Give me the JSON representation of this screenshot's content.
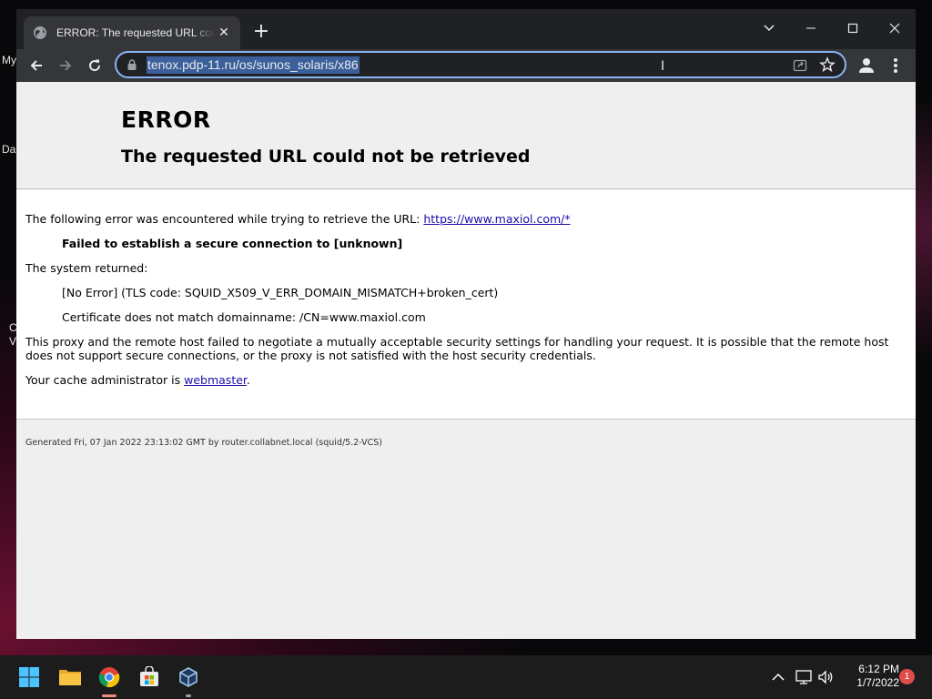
{
  "desktop": {
    "labels": [
      "My",
      "Da",
      "C",
      "V"
    ]
  },
  "browser": {
    "tab": {
      "title": "ERROR: The requested URL could not be retrieved",
      "favicon": "globe-icon"
    },
    "window_controls": [
      "chevron-down-icon",
      "minimize-icon",
      "maximize-icon",
      "close-icon"
    ],
    "address_bar": {
      "url": "tenox.pdp-11.ru/os/sunos_solaris/x86"
    },
    "accent_color": "#8ab4f8"
  },
  "page": {
    "heading": "ERROR",
    "subheading": "The requested URL could not be retrieved",
    "intro_text": "The following error was encountered while trying to retrieve the URL: ",
    "intro_link": "https://www.maxiol.com/*",
    "failure": "Failed to establish a secure connection to [unknown]",
    "system_returned": "The system returned:",
    "error_code": "[No Error] (TLS code: SQUID_X509_V_ERR_DOMAIN_MISMATCH+broken_cert)",
    "cert_detail": "Certificate does not match domainname: /CN=www.maxiol.com",
    "explanation": "This proxy and the remote host failed to negotiate a mutually acceptable security settings for handling your request. It is possible that the remote host does not support secure connections, or the proxy is not satisfied with the host security credentials.",
    "admin_prefix": "Your cache administrator is ",
    "admin_link": "webmaster",
    "admin_suffix": ".",
    "footer": "Generated Fri, 07 Jan 2022 23:13:02 GMT by router.collabnet.local (squid/5.2-VCS)"
  },
  "taskbar": {
    "apps": [
      "windows-start-icon",
      "file-explorer-icon",
      "chrome-icon",
      "store-icon",
      "virtualbox-icon"
    ],
    "tray_icons": [
      "chevron-up-icon",
      "network-icon",
      "volume-icon"
    ],
    "time": "6:12 PM",
    "date": "1/7/2022",
    "notification_count": "1"
  }
}
